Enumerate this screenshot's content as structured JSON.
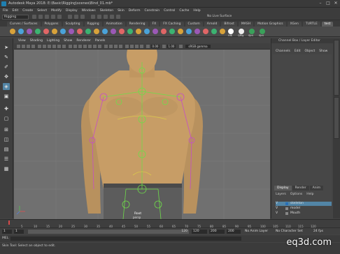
{
  "window": {
    "title": "Autodesk Maya 2018: E:\\Basic\\Rigging\\scenes\\Bind_01.mb*",
    "controls": [
      "–",
      "□",
      "✕"
    ]
  },
  "menubar": [
    "File",
    "Edit",
    "Create",
    "Select",
    "Modify",
    "Display",
    "Windows",
    "Skeleton",
    "Skin",
    "Deform",
    "Constrain",
    "Control",
    "Cache",
    "Help"
  ],
  "status_line": {
    "mode": "Rigging",
    "live_surface": "No Live Surface"
  },
  "shelf_tabs": [
    {
      "label": "Curves / Surfaces",
      "active": false
    },
    {
      "label": "Polygons",
      "active": false
    },
    {
      "label": "Sculpting",
      "active": false
    },
    {
      "label": "Rigging",
      "active": false
    },
    {
      "label": "Animation",
      "active": false
    },
    {
      "label": "Rendering",
      "active": false
    },
    {
      "label": "FX",
      "active": false
    },
    {
      "label": "FX Caching",
      "active": false
    },
    {
      "label": "Custom",
      "active": false
    },
    {
      "label": "Arnold",
      "active": false
    },
    {
      "label": "Bifrost",
      "active": false
    },
    {
      "label": "MASH",
      "active": false
    },
    {
      "label": "Motion Graphics",
      "active": false
    },
    {
      "label": "XGen",
      "active": false
    },
    {
      "label": "TURTLE",
      "active": false
    },
    {
      "label": "test",
      "active": true
    }
  ],
  "shelf_labels": [
    "HIK",
    "QRig",
    "SJnt",
    "SJnt"
  ],
  "panel_menu": [
    "View",
    "Shading",
    "Lighting",
    "Show",
    "Renderer",
    "Panels"
  ],
  "panel_toolbar": {
    "field1": "0.00",
    "field2": "1.00",
    "colorspace": "sRGB gamma"
  },
  "viewport": {
    "camera_label": "persp",
    "joint_label": "Root"
  },
  "right_panel": {
    "title": "Channel Box / Layer Editor",
    "menu": [
      "Channels",
      "Edit",
      "Object",
      "Show"
    ],
    "layer_tabs": [
      {
        "label": "Display",
        "active": true
      },
      {
        "label": "Render",
        "active": false
      },
      {
        "label": "Anim",
        "active": false
      }
    ],
    "layer_menu": [
      "Layers",
      "Options",
      "Help"
    ],
    "layers": [
      {
        "vis": "V",
        "name": "skeleton",
        "color": "#2a6fb5",
        "selected": true
      },
      {
        "vis": "V",
        "name": "model",
        "color": "#888888",
        "selected": false
      },
      {
        "vis": "V",
        "name": "Mouth",
        "color": "#888888",
        "selected": false
      }
    ]
  },
  "side_tabs": [
    "Channel Box / Layer Editor",
    "Attribute Editor"
  ],
  "time_slider": {
    "ticks": [
      "5",
      "10",
      "15",
      "20",
      "25",
      "30",
      "35",
      "40",
      "45",
      "50",
      "55",
      "60",
      "65",
      "70",
      "75",
      "80",
      "85",
      "90",
      "95",
      "100",
      "105",
      "110",
      "115",
      "120"
    ],
    "current_frame": "1"
  },
  "range_slider": {
    "start": "1",
    "playback_start": "1",
    "range_end": "120",
    "end": "120",
    "anim_end": "200",
    "anim_end_b": "200",
    "anim_layer": "No Anim Layer",
    "char_set": "No Character Set",
    "fps": "24 fps"
  },
  "command_line": {
    "label": "MEL"
  },
  "help_line": {
    "text": "Skin Tool: Select an object to edit."
  },
  "watermark": "eq3d.com"
}
